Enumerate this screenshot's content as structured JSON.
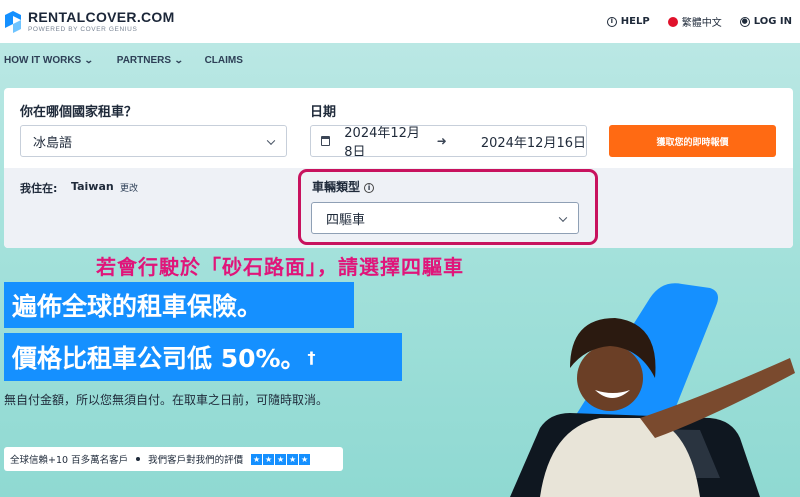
{
  "header": {
    "brand_name": "RENTALCOVER.COM",
    "brand_sub": "POWERED BY COVER GENIUS",
    "help": "HELP",
    "language": "繁體中文",
    "login": "LOG IN"
  },
  "subnav": {
    "items": [
      {
        "label": "HOW IT WORKS",
        "has_dropdown": true
      },
      {
        "label": "PARTNERS",
        "has_dropdown": true
      },
      {
        "label": "CLAIMS",
        "has_dropdown": false
      }
    ]
  },
  "search": {
    "country_label": "你在哪個國家租車？",
    "country_value": "冰島語",
    "dates_label": "日期",
    "start_date": "2024年12月8日",
    "end_date": "2024年12月16日",
    "cta": "獲取您的即時報價",
    "live_label": "我住在:",
    "live_value": "Taiwan",
    "change_link": "更改",
    "vehicle_label": "車輛類型",
    "vehicle_value": "四驅車"
  },
  "annotation": "若會行駛於「砂石路面」，請選擇四驅車",
  "hero": {
    "line1": "遍佈全球的租車保險。",
    "line2": "價格比租車公司低 50%。",
    "line2_mark": "†",
    "desc": "無自付金額，所以您無須自付。在取車之日前，可隨時取消。",
    "trust_text": "全球信賴+10 百多萬名客戶",
    "review_text": "我們客戶對我們的評價",
    "stars": 5
  },
  "colors": {
    "accent": "#1590ff",
    "cta": "#ff6a13",
    "annotation": "#e0157a",
    "highlight": "#c8125e"
  }
}
